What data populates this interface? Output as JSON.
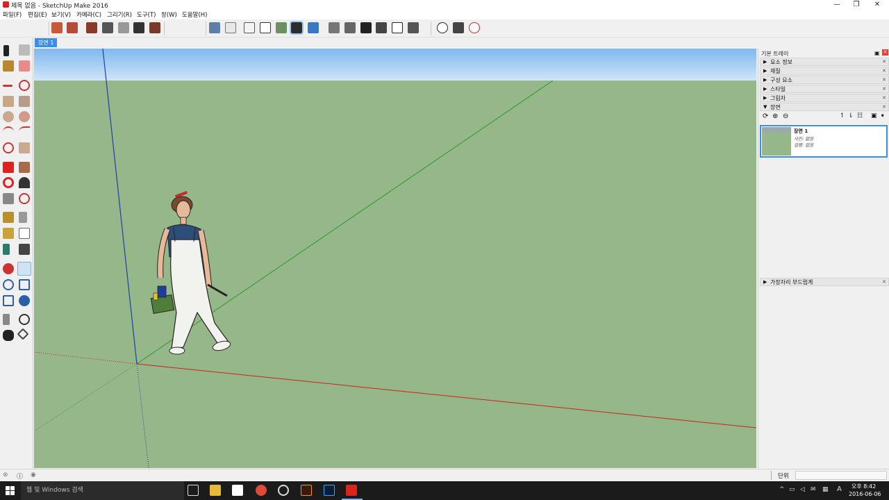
{
  "window": {
    "title": "제목 없음 - SketchUp Make 2016",
    "minimize": "—",
    "restore": "❐",
    "close": "✕"
  },
  "menu": [
    "파일(F)",
    "편집(E)",
    "보기(V)",
    "카메라(C)",
    "그리기(R)",
    "도구(T)",
    "창(W)",
    "도움말(H)"
  ],
  "toolbar": {
    "icons": [
      "views-iso-icon",
      "views-top-icon",
      "views-front-icon",
      "views-right-icon",
      "views-back-icon",
      "views-left-icon",
      "style-xray-icon",
      "style-backedges-icon",
      "style-wireframe-icon",
      "style-hidden-line-icon",
      "style-shaded-icon",
      "style-shaded-textures-icon",
      "style-monochrome-icon",
      "warehouse-icon",
      "extension-warehouse-icon",
      "share-model-icon",
      "component-icon",
      "house-icon",
      "layout-icon",
      "position-camera-icon",
      "look-around-icon",
      "walk-icon"
    ]
  },
  "scene_tab": "장면 1",
  "tray": {
    "title": "기본 트레이",
    "panels": [
      {
        "label": "요소 정보",
        "open": false
      },
      {
        "label": "재질",
        "open": false
      },
      {
        "label": "구성 요소",
        "open": false
      },
      {
        "label": "스타일",
        "open": false
      },
      {
        "label": "그림자",
        "open": false
      },
      {
        "label": "장면",
        "open": true
      }
    ],
    "scene_card": {
      "name": "장면 1",
      "line1": "사진: 없음",
      "line2": "설명: 없음"
    },
    "soften_panel": "가장자리 부드럽게"
  },
  "status": {
    "units_label": "단위"
  },
  "taskbar": {
    "search_placeholder": "웹 및 Windows 검색",
    "clock_time": "오후 8:42",
    "clock_date": "2016-06-06",
    "ime": "A"
  },
  "colors": {
    "sky_top": "#7fb8ee",
    "sky_bottom": "#cfe5f7",
    "ground": "#95b78a",
    "axis_red": "#cc2222",
    "axis_green": "#2a9a2a",
    "axis_blue": "#1e3fa8",
    "accent": "#3a8ee6"
  }
}
